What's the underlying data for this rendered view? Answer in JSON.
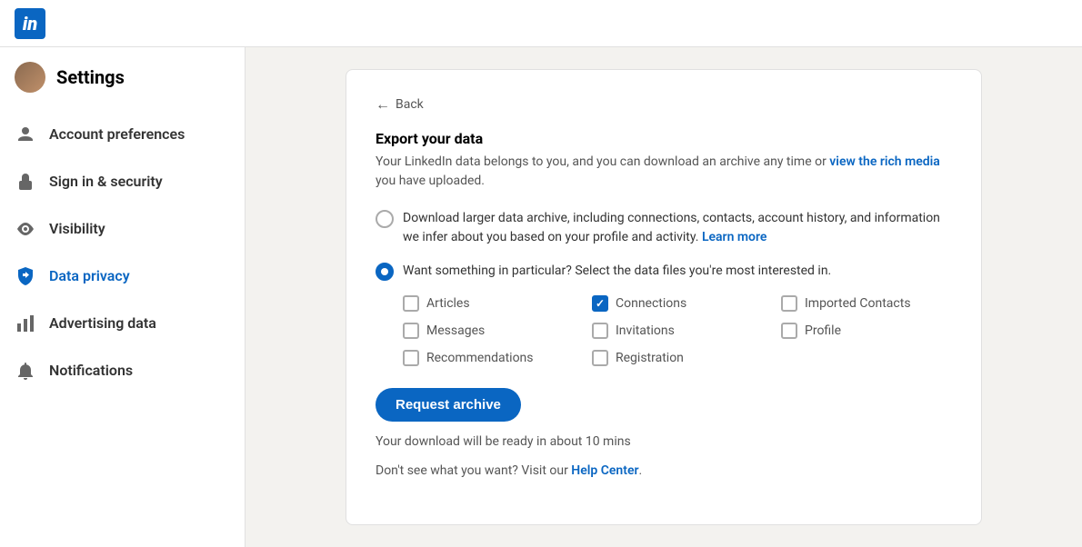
{
  "topbar": {
    "logo_text": "in"
  },
  "sidebar": {
    "title": "Settings",
    "items": [
      {
        "id": "account-preferences",
        "label": "Account preferences",
        "icon": "person-icon",
        "active": false
      },
      {
        "id": "sign-in-security",
        "label": "Sign in & security",
        "icon": "lock-icon",
        "active": false
      },
      {
        "id": "visibility",
        "label": "Visibility",
        "icon": "eye-icon",
        "active": false
      },
      {
        "id": "data-privacy",
        "label": "Data privacy",
        "icon": "shield-icon",
        "active": true
      },
      {
        "id": "advertising-data",
        "label": "Advertising data",
        "icon": "chart-icon",
        "active": false
      },
      {
        "id": "notifications",
        "label": "Notifications",
        "icon": "bell-icon",
        "active": false
      }
    ]
  },
  "card": {
    "back_label": "Back",
    "title": "Export your data",
    "description_plain": "Your LinkedIn data belongs to you, and you can download an archive any time or ",
    "description_link": "view the rich media",
    "description_end": " you have uploaded.",
    "option1_text": "Download larger data archive, including connections, contacts, account history, and information we infer about you based on your profile and activity.",
    "option1_link": "Learn more",
    "option2_text": "Want something in particular? Select the data files you're most interested in.",
    "checkboxes": [
      {
        "id": "articles",
        "label": "Articles",
        "checked": false
      },
      {
        "id": "connections",
        "label": "Connections",
        "checked": true
      },
      {
        "id": "imported-contacts",
        "label": "Imported Contacts",
        "checked": false
      },
      {
        "id": "messages",
        "label": "Messages",
        "checked": false
      },
      {
        "id": "invitations",
        "label": "Invitations",
        "checked": false
      },
      {
        "id": "profile",
        "label": "Profile",
        "checked": false
      },
      {
        "id": "recommendations",
        "label": "Recommendations",
        "checked": false
      },
      {
        "id": "registration",
        "label": "Registration",
        "checked": false
      }
    ],
    "button_label": "Request archive",
    "download_info": "Your download will be ready in about 10 mins",
    "help_text_plain": "Don't see what you want? Visit our ",
    "help_link": "Help Center",
    "help_text_end": "."
  }
}
